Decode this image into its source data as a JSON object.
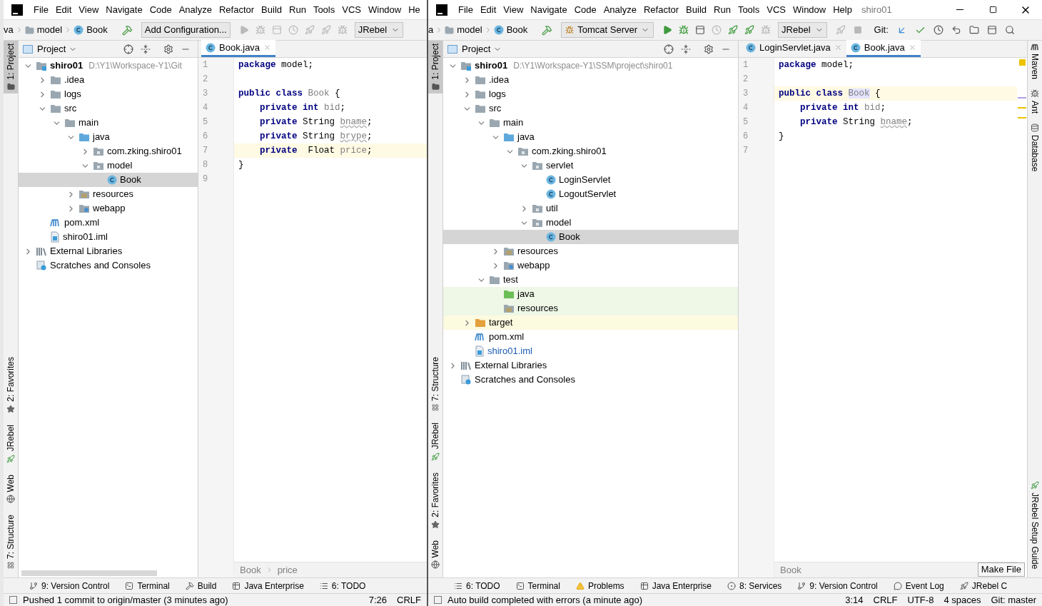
{
  "windows": [
    {
      "menu": [
        "File",
        "Edit",
        "View",
        "Navigate",
        "Code",
        "Analyze",
        "Refactor",
        "Build",
        "Run",
        "Tools",
        "VCS",
        "Window",
        "He"
      ],
      "breadcrumb": [
        "va",
        "model",
        "Book"
      ],
      "toolbar": {
        "config": {
          "label": "Add Configuration...",
          "kind": "button"
        },
        "run_enabled": false,
        "rebel": "JRebel"
      },
      "side_strip_top": [
        {
          "label": "1: Project",
          "kind": "project",
          "selected": true
        }
      ],
      "side_strip_bottom": [
        {
          "label": "2: Favorites",
          "kind": "favorites",
          "selected": false
        },
        {
          "label": "JRebel",
          "kind": "jrebel",
          "selected": false
        },
        {
          "label": "Web",
          "kind": "web",
          "selected": false
        },
        {
          "label": "7: Structure",
          "kind": "structure",
          "selected": false
        }
      ],
      "project": {
        "header": "Project",
        "tree": [
          {
            "name": "shiro01",
            "kind": "module",
            "path": "D:\\Y1\\Workspace-Y1\\Git",
            "expanded": true,
            "selected": false,
            "children": [
              {
                "name": ".idea",
                "kind": "folder",
                "expanded": false,
                "selected": false
              },
              {
                "name": "logs",
                "kind": "folder",
                "expanded": false,
                "selected": false
              },
              {
                "name": "src",
                "kind": "folder",
                "expanded": true,
                "selected": false,
                "children": [
                  {
                    "name": "main",
                    "kind": "folder",
                    "expanded": true,
                    "selected": false,
                    "children": [
                      {
                        "name": "java",
                        "kind": "source",
                        "expanded": true,
                        "selected": false,
                        "children": [
                          {
                            "name": "com.zking.shiro01",
                            "kind": "package",
                            "expanded": false,
                            "selected": false
                          },
                          {
                            "name": "model",
                            "kind": "package",
                            "expanded": true,
                            "selected": false,
                            "children": [
                              {
                                "name": "Book",
                                "kind": "class",
                                "selected": true
                              }
                            ]
                          }
                        ]
                      },
                      {
                        "name": "resources",
                        "kind": "resources",
                        "expanded": false,
                        "selected": false
                      },
                      {
                        "name": "webapp",
                        "kind": "webapp",
                        "expanded": false,
                        "selected": false
                      }
                    ]
                  }
                ]
              },
              {
                "name": "pom.xml",
                "kind": "maven",
                "selected": false
              },
              {
                "name": "shiro01.iml",
                "kind": "iml",
                "selected": false,
                "modified": false
              }
            ]
          },
          {
            "name": "External Libraries",
            "kind": "libs",
            "expanded": false,
            "selected": false
          },
          {
            "name": "Scratches and Consoles",
            "kind": "scratches",
            "selected": false
          }
        ]
      },
      "editor": {
        "tabs": [
          {
            "label": "Book.java",
            "selected": true
          }
        ],
        "lines": [
          {
            "number": "1",
            "current": false,
            "tokens": [
              {
                "kind": "kw",
                "text": "package"
              },
              {
                "kind": "text",
                "text": " model;"
              }
            ]
          },
          {
            "number": "2",
            "current": false
          },
          {
            "number": "3",
            "current": false,
            "tokens": [
              {
                "kind": "kw",
                "text": "public class "
              },
              {
                "kind": "dim",
                "text": "Book"
              },
              {
                "kind": "text",
                "text": " {"
              }
            ]
          },
          {
            "number": "4",
            "current": false,
            "tokens": [
              {
                "kind": "kw",
                "text": "    private int "
              },
              {
                "kind": "dim",
                "text": "bid"
              },
              {
                "kind": "text",
                "text": ";"
              }
            ]
          },
          {
            "number": "5",
            "current": false,
            "tokens": [
              {
                "kind": "kw",
                "text": "    private "
              },
              {
                "kind": "text",
                "text": "String "
              },
              {
                "kind": "squiggle",
                "text": "bname"
              },
              {
                "kind": "text",
                "text": ";"
              }
            ]
          },
          {
            "number": "6",
            "current": false,
            "tokens": [
              {
                "kind": "kw",
                "text": "    private "
              },
              {
                "kind": "text",
                "text": "String "
              },
              {
                "kind": "squiggle",
                "text": "brype"
              },
              {
                "kind": "text",
                "text": ";"
              }
            ]
          },
          {
            "number": "7",
            "current": true,
            "tokens": [
              {
                "kind": "kw",
                "text": "    private  "
              },
              {
                "kind": "text",
                "text": "Float "
              },
              {
                "kind": "dim",
                "text": "price"
              },
              {
                "kind": "text",
                "text": ";"
              }
            ]
          },
          {
            "number": "8",
            "current": false,
            "tokens": [
              {
                "kind": "text",
                "text": "}"
              }
            ]
          },
          {
            "number": "9",
            "current": false
          }
        ],
        "breadcrumb": [
          "Book",
          "price"
        ]
      },
      "tool_tabs": [
        {
          "label": "9: Version Control",
          "kind": "vcs"
        },
        {
          "label": "Terminal",
          "kind": "terminal"
        },
        {
          "label": "Build",
          "kind": "build"
        },
        {
          "label": "Java Enterprise",
          "kind": "enterprise"
        },
        {
          "label": "6: TODO",
          "kind": "todo"
        }
      ],
      "status": {
        "message": "Pushed 1 commit to origin/master (3 minutes ago)",
        "items": [
          "7:26",
          "CRLF"
        ]
      }
    },
    {
      "menu": [
        "File",
        "Edit",
        "View",
        "Navigate",
        "Code",
        "Analyze",
        "Refactor",
        "Build",
        "Run",
        "Tools",
        "VCS",
        "Window",
        "Help"
      ],
      "title": "shiro01",
      "breadcrumb": [
        "a",
        "model",
        "Book"
      ],
      "toolbar": {
        "config": {
          "label": "Tomcat Server",
          "kind": "dropdown"
        },
        "run_enabled": true,
        "rebel": "JRebel",
        "git": "Git:"
      },
      "side_strip_top": [
        {
          "label": "1: Project",
          "kind": "project",
          "selected": true
        }
      ],
      "side_strip_bottom": [
        {
          "label": "7: Structure",
          "kind": "structure",
          "selected": false
        },
        {
          "label": "JRebel",
          "kind": "jrebel",
          "selected": false
        },
        {
          "label": "2: Favorites",
          "kind": "favorites",
          "selected": false
        },
        {
          "label": "Web",
          "kind": "web",
          "selected": false
        }
      ],
      "right_strip_top": [
        {
          "label": "Maven",
          "kind": "maven"
        },
        {
          "label": "Ant",
          "kind": "ant"
        },
        {
          "label": "Database",
          "kind": "database"
        }
      ],
      "right_strip_bottom": [
        {
          "label": "JRebel Setup Guide",
          "kind": "jrebel"
        }
      ],
      "project": {
        "header": "Project",
        "tree": [
          {
            "name": "shiro01",
            "kind": "module",
            "path": "D:\\Y1\\Workspace-Y1\\SSM\\project\\shiro01",
            "expanded": true,
            "selected": false,
            "children": [
              {
                "name": ".idea",
                "kind": "folder",
                "expanded": false,
                "selected": false
              },
              {
                "name": "logs",
                "kind": "folder",
                "expanded": false,
                "selected": false
              },
              {
                "name": "src",
                "kind": "folder",
                "expanded": true,
                "selected": false,
                "children": [
                  {
                    "name": "main",
                    "kind": "folder",
                    "expanded": true,
                    "selected": false,
                    "children": [
                      {
                        "name": "java",
                        "kind": "source",
                        "expanded": true,
                        "selected": false,
                        "children": [
                          {
                            "name": "com.zking.shiro01",
                            "kind": "package",
                            "expanded": true,
                            "selected": false,
                            "children": [
                              {
                                "name": "servlet",
                                "kind": "package",
                                "expanded": true,
                                "selected": false,
                                "children": [
                                  {
                                    "name": "LoginServlet",
                                    "kind": "class",
                                    "selected": false
                                  },
                                  {
                                    "name": "LogoutServlet",
                                    "kind": "class",
                                    "selected": false
                                  }
                                ]
                              },
                              {
                                "name": "util",
                                "kind": "package",
                                "expanded": false,
                                "selected": false
                              },
                              {
                                "name": "model",
                                "kind": "package",
                                "expanded": true,
                                "selected": false,
                                "children": [
                                  {
                                    "name": "Book",
                                    "kind": "class",
                                    "selected": true
                                  }
                                ]
                              }
                            ]
                          }
                        ]
                      },
                      {
                        "name": "resources",
                        "kind": "resources",
                        "expanded": false,
                        "selected": false
                      },
                      {
                        "name": "webapp",
                        "kind": "webapp",
                        "expanded": false,
                        "selected": false
                      }
                    ]
                  },
                  {
                    "name": "test",
                    "kind": "folder",
                    "expanded": true,
                    "selected": false,
                    "children": [
                      {
                        "name": "java",
                        "kind": "test-source",
                        "selected": false
                      },
                      {
                        "name": "resources",
                        "kind": "test-resources",
                        "selected": false
                      }
                    ]
                  }
                ]
              },
              {
                "name": "target",
                "kind": "excluded",
                "expanded": false,
                "selected": false
              },
              {
                "name": "pom.xml",
                "kind": "maven",
                "selected": false
              },
              {
                "name": "shiro01.iml",
                "kind": "iml",
                "selected": false,
                "modified": true
              }
            ]
          },
          {
            "name": "External Libraries",
            "kind": "libs",
            "expanded": false,
            "selected": false
          },
          {
            "name": "Scratches and Consoles",
            "kind": "scratches",
            "selected": false
          }
        ]
      },
      "editor": {
        "tabs": [
          {
            "label": "LoginServlet.java",
            "selected": false
          },
          {
            "label": "Book.java",
            "selected": true
          }
        ],
        "lines": [
          {
            "number": "1",
            "current": false,
            "tokens": [
              {
                "kind": "kw",
                "text": "package"
              },
              {
                "kind": "text",
                "text": " model;"
              }
            ]
          },
          {
            "number": "2",
            "current": false
          },
          {
            "number": "3",
            "current": true,
            "tokens": [
              {
                "kind": "kw",
                "text": "public class "
              },
              {
                "kind": "marked",
                "text": "Book"
              },
              {
                "kind": "text",
                "text": " {"
              }
            ]
          },
          {
            "number": "4",
            "current": false,
            "tokens": [
              {
                "kind": "kw",
                "text": "    private int "
              },
              {
                "kind": "dim",
                "text": "bid"
              },
              {
                "kind": "text",
                "text": ";"
              }
            ]
          },
          {
            "number": "5",
            "current": false,
            "tokens": [
              {
                "kind": "kw",
                "text": "    private "
              },
              {
                "kind": "text",
                "text": "String "
              },
              {
                "kind": "squiggle",
                "text": "bname"
              },
              {
                "kind": "text",
                "text": ";"
              }
            ]
          },
          {
            "number": "6",
            "current": false,
            "tokens": [
              {
                "kind": "text",
                "text": "}"
              }
            ]
          },
          {
            "number": "7",
            "current": false
          }
        ],
        "breadcrumb": [
          "Book"
        ]
      },
      "tool_tabs": [
        {
          "label": "6: TODO",
          "kind": "todo"
        },
        {
          "label": "Terminal",
          "kind": "terminal"
        },
        {
          "label": "Problems",
          "kind": "problems"
        },
        {
          "label": "Java Enterprise",
          "kind": "enterprise"
        },
        {
          "label": "8: Services",
          "kind": "services"
        },
        {
          "label": "9: Version Control",
          "kind": "vcs"
        },
        {
          "label": "Event Log",
          "kind": "eventlog"
        },
        {
          "label": "JRebel C",
          "kind": "jrebel"
        }
      ],
      "tooltip": "Make File",
      "status": {
        "message": "Auto build completed with errors (a minute ago)",
        "items": [
          "3:14",
          "CRLF",
          "UTF-8",
          "4 spaces",
          "Git: master"
        ]
      }
    }
  ]
}
